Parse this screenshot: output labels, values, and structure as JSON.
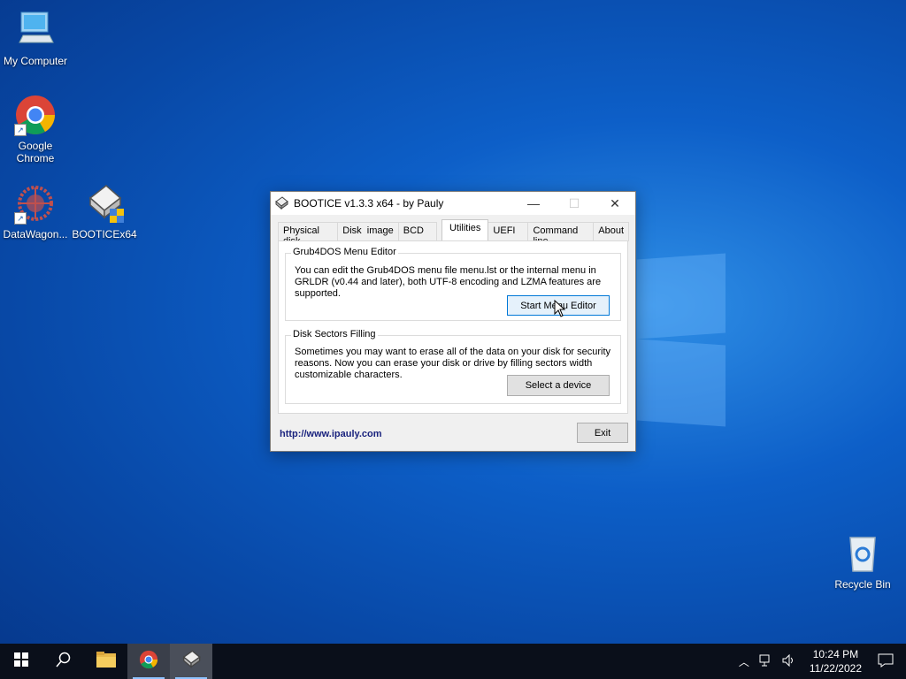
{
  "desktop": {
    "icons": [
      {
        "label": "My Computer",
        "icon": "computer-icon"
      },
      {
        "label": "Google Chrome",
        "icon": "chrome-icon"
      },
      {
        "label": "DataWagon...",
        "icon": "datawagon-icon"
      },
      {
        "label": "BOOTICEx64",
        "icon": "bootice-icon"
      },
      {
        "label": "Recycle Bin",
        "icon": "recycle-bin-icon"
      }
    ]
  },
  "window": {
    "title": "BOOTICE v1.3.3 x64 - by Pauly",
    "tabs": [
      "Physical disk",
      "Disk  image",
      "BCD",
      "Utilities",
      "UEFI",
      "Command line",
      "About"
    ],
    "active_tab": "Utilities",
    "grub_group": {
      "title": "Grub4DOS Menu Editor",
      "text": "You can edit the Grub4DOS menu file menu.lst or the internal menu in GRLDR (v0.44 and later), both UTF-8 encoding and LZMA features are supported.",
      "button": "Start Menu Editor"
    },
    "fill_group": {
      "title": "Disk Sectors Filling",
      "text": "Sometimes you may want to erase all of the data on your disk for security reasons. Now you can erase your disk or drive by filling sectors width customizable characters.",
      "button": "Select a device"
    },
    "link": "http://www.ipauly.com",
    "exit_button": "Exit"
  },
  "taskbar": {
    "time": "10:24 PM",
    "date": "11/22/2022",
    "accent": "#8ec3ff"
  }
}
